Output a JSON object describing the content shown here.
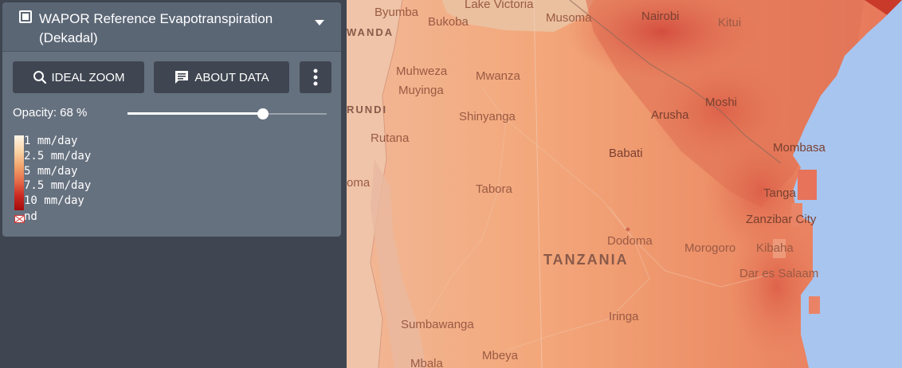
{
  "layer": {
    "title": "WAPOR Reference Evapotranspiration (Dekadal)",
    "checked": true
  },
  "buttons": {
    "ideal_zoom": "IDEAL ZOOM",
    "about_data": "ABOUT DATA"
  },
  "opacity": {
    "label": "Opacity: 68 %",
    "value_percent": 68
  },
  "legend": {
    "items": [
      "1 mm/day",
      "2.5 mm/day",
      "5 mm/day",
      "7.5 mm/day",
      "10 mm/day"
    ],
    "nodata": "nd",
    "colors": [
      "#fdf4e6",
      "#fbd3a5",
      "#f3a26a",
      "#e56a48",
      "#cc2a22",
      "#a40b0b"
    ]
  },
  "icons": {
    "checkbox": "checkbox-icon",
    "dropdown": "chevron-down-icon",
    "zoom": "search-icon",
    "about": "message-icon",
    "more": "more-vertical-icon",
    "nodata": "nodata-icon"
  },
  "map": {
    "country": "TANZANIA",
    "cities": {
      "byumba": "Byumba",
      "bukoba": "Bukoba",
      "lake_victoria": "Lake Victoria",
      "musoma": "Musoma",
      "nairobi": "Nairobi",
      "kitui": "Kitui",
      "rwanda": "WANDA",
      "muhweza": "Muhweza",
      "muyinga": "Muyinga",
      "mwanza": "Mwanza",
      "burundi": "RUNDI",
      "shinyanga": "Shinyanga",
      "moshi": "Moshi",
      "arusha": "Arusha",
      "rutana": "Rutana",
      "babati": "Babati",
      "mombasa": "Mombasa",
      "kigoma": "oma",
      "tabora": "Tabora",
      "tanga": "Tanga",
      "zanzibar": "Zanzibar City",
      "dodoma": "Dodoma",
      "morogoro": "Morogoro",
      "kibaha": "Kibaha",
      "dar": "Dar es Salaam",
      "sumbawanga": "Sumbawanga",
      "iringa": "Iringa",
      "mbeya": "Mbeya",
      "mbala": "Mbala"
    },
    "colors": {
      "sea": "#a8c5ef",
      "land_base": "#f1ab7f",
      "high_et": "#dc5a48"
    }
  }
}
